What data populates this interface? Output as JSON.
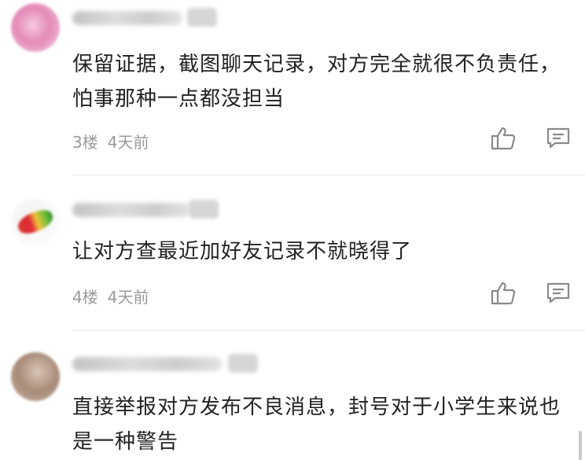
{
  "comments": [
    {
      "text": "保留证据，截图聊天记录，对方完全就很不负责任，怕事那种一点都没担当",
      "floor": "3楼",
      "time": "4天前",
      "avatar_colors": [
        "#e58ab8",
        "#f5c9dd"
      ]
    },
    {
      "text": "让对方查最近加好友记录不就晓得了",
      "floor": "4楼",
      "time": "4天前",
      "avatar_colors": [
        "#6fbf3a",
        "#e0283a"
      ]
    },
    {
      "text": "直接举报对方发布不良消息，封号对于小学生来说也是一种警告",
      "floor": "",
      "time": "",
      "avatar_colors": [
        "#a88b78",
        "#d8c6b8"
      ]
    }
  ],
  "icons": {
    "like": "thumbs-up-icon",
    "reply": "comment-icon"
  },
  "colors": {
    "meta_text": "#9a9a9a",
    "divider": "#e8e8e8",
    "icon_stroke": "#8a8a8a"
  }
}
